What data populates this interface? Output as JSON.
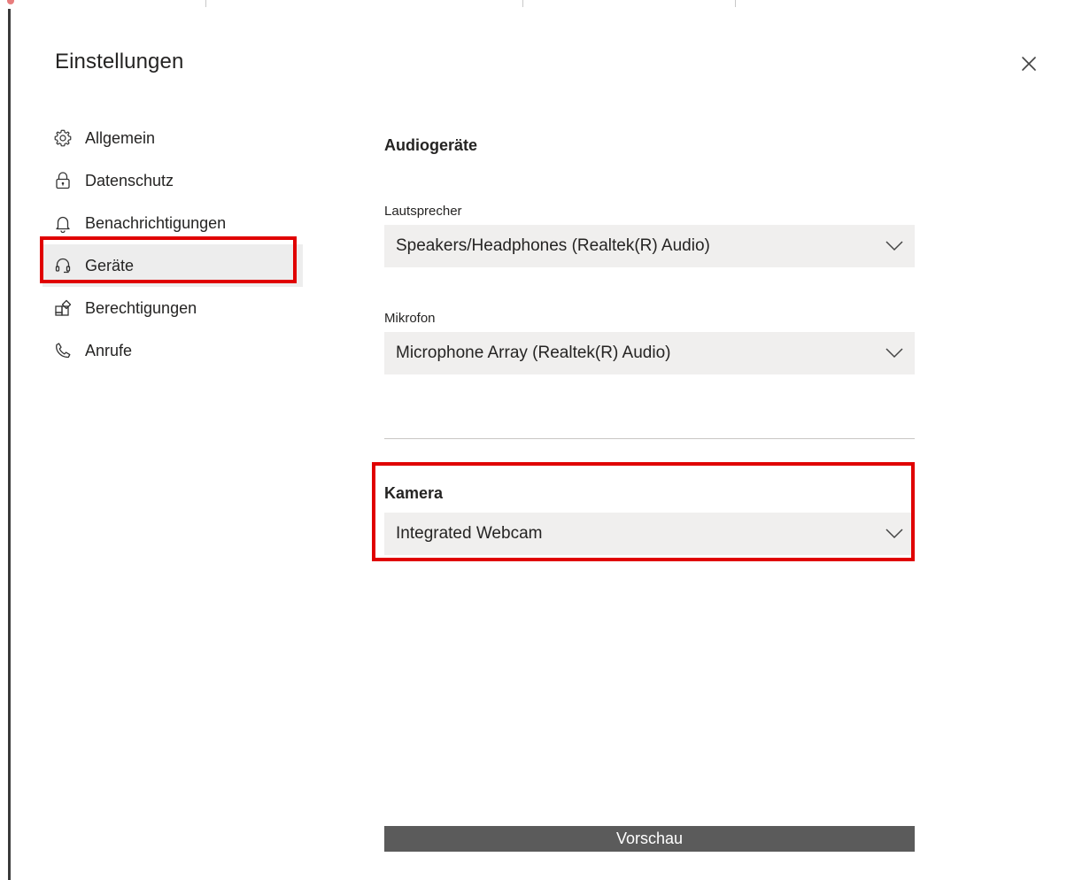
{
  "dialog": {
    "title": "Einstellungen"
  },
  "nav": {
    "items": [
      {
        "label": "Allgemein",
        "icon": "gear-icon"
      },
      {
        "label": "Datenschutz",
        "icon": "lock-icon"
      },
      {
        "label": "Benachrichtigungen",
        "icon": "bell-icon"
      },
      {
        "label": "Geräte",
        "icon": "headset-icon",
        "active": true
      },
      {
        "label": "Berechtigungen",
        "icon": "apps-icon"
      },
      {
        "label": "Anrufe",
        "icon": "phone-icon"
      }
    ]
  },
  "audio": {
    "heading": "Audiogeräte",
    "speaker_label": "Lautsprecher",
    "speaker_value": "Speakers/Headphones (Realtek(R) Audio)",
    "mic_label": "Mikrofon",
    "mic_value": "Microphone Array (Realtek(R) Audio)"
  },
  "camera": {
    "heading": "Kamera",
    "value": "Integrated Webcam"
  },
  "preview": {
    "label": "Vorschau"
  },
  "colors": {
    "highlight": "#e00000",
    "select_bg": "#f0efee",
    "active_nav_bg": "#ededed",
    "preview_bg": "#5b5b5b"
  }
}
